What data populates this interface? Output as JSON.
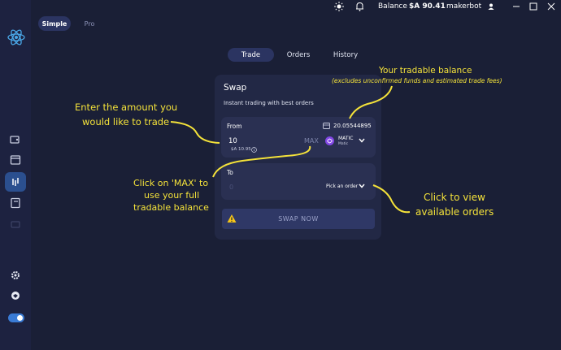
{
  "topbar": {
    "balance_label": "Balance",
    "balance_value": "$A 90.41",
    "username": "makerbot",
    "icons": [
      "sun-icon",
      "bell-icon",
      "user-icon",
      "minimize-icon",
      "maximize-icon",
      "close-icon"
    ]
  },
  "mode_tabs": {
    "simple": "Simple",
    "pro": "Pro"
  },
  "nav_tabs": {
    "trade": "Trade",
    "orders": "Orders",
    "history": "History"
  },
  "swap": {
    "title": "Swap",
    "subtitle": "Instant trading with best orders",
    "from": {
      "label": "From",
      "balance": "20.05544895",
      "amount": "10",
      "fiat_value": "$A 10.95",
      "max_label": "MAX",
      "coin_ticker": "MATIC",
      "coin_name": "Matic"
    },
    "to": {
      "label": "To",
      "amount_placeholder": "0",
      "pick_order_label": "Pick an order"
    },
    "swap_button": "SWAP NOW"
  },
  "annotations": {
    "tradable_balance_title": "Your tradable balance",
    "tradable_balance_note": "(excludes unconfirmed funds and estimated trade fees)",
    "enter_amount_line1": "Enter the amount you",
    "enter_amount_line2": "would like to trade",
    "max_line1": "Click on 'MAX' to",
    "max_line2": "use your full",
    "max_line3": "tradable balance",
    "orders_line1": "Click to view",
    "orders_line2": "available orders"
  },
  "colors": {
    "background": "#1a1f36",
    "card": "#222845",
    "accent": "#3a7bd5",
    "annotation": "#f4e23a",
    "warning": "#f5c518",
    "matic": "#8247e5"
  }
}
